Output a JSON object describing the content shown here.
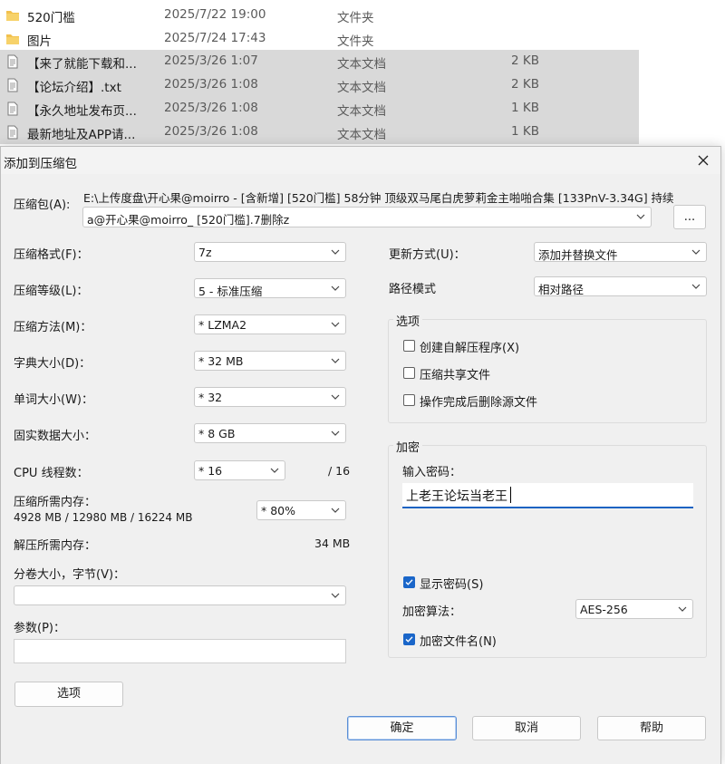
{
  "files": [
    {
      "name": "520门槛",
      "date": "2025/7/22 19:00",
      "type": "文件夹",
      "size": "",
      "icon": "folder-icon",
      "selected": false
    },
    {
      "name": "图片",
      "date": "2025/7/24 17:43",
      "type": "文件夹",
      "size": "",
      "icon": "folder-icon",
      "selected": false
    },
    {
      "name": "【来了就能下载和...",
      "date": "2025/3/26 1:07",
      "type": "文本文档",
      "size": "2 KB",
      "icon": "text-file-icon",
      "selected": true
    },
    {
      "name": "【论坛介绍】.txt",
      "date": "2025/3/26 1:08",
      "type": "文本文档",
      "size": "2 KB",
      "icon": "text-file-icon",
      "selected": true
    },
    {
      "name": "【永久地址发布页...",
      "date": "2025/3/26 1:08",
      "type": "文本文档",
      "size": "1 KB",
      "icon": "text-file-icon",
      "selected": true
    },
    {
      "name": "最新地址及APP请...",
      "date": "2025/3/26 1:08",
      "type": "文本文档",
      "size": "1 KB",
      "icon": "text-file-icon",
      "selected": true
    }
  ],
  "dialog": {
    "title": "添加到压缩包",
    "archive_label": "压缩包(A):",
    "archive_path_line1": "E:\\上传度盘\\开心果@moirro - [含新增] [520门槛] 58分钟 顶级双马尾白虎萝莉金主啪啪合集 [133PnV-3.34G] 持续",
    "archive_path_line2": "a@开心果@moirro_ [520门槛].7删除z",
    "browse_label": "...",
    "left": {
      "format_label": "压缩格式(F)：",
      "format_value": "7z",
      "level_label": "压缩等级(L)：",
      "level_value": "5 - 标准压缩",
      "method_label": "压缩方法(M)：",
      "method_value": "* LZMA2",
      "dict_label": "字典大小(D)：",
      "dict_value": "* 32 MB",
      "word_label": "单词大小(W)：",
      "word_value": "* 32",
      "solid_label": "固实数据大小：",
      "solid_value": "* 8 GB",
      "cpu_label": "CPU 线程数：",
      "cpu_value": "* 16",
      "cpu_total": "/ 16",
      "mem_comp_label": "压缩所需内存：",
      "mem_comp_detail": "4928 MB / 12980 MB / 16224 MB",
      "mem_percent": "* 80%",
      "mem_decomp_label": "解压所需内存：",
      "mem_decomp_value": "34 MB",
      "volume_label": "分卷大小，字节(V)：",
      "volume_value": "",
      "params_label": "参数(P)：",
      "params_value": "",
      "options_button": "选项"
    },
    "right": {
      "update_label": "更新方式(U)：",
      "update_value": "添加并替换文件",
      "path_label": "路径模式",
      "path_value": "相对路径",
      "options_group": "选项",
      "opt_sfx": "创建自解压程序(X)",
      "opt_sfx_checked": false,
      "opt_shared": "压缩共享文件",
      "opt_shared_checked": false,
      "opt_delete": "操作完成后删除源文件",
      "opt_delete_checked": false,
      "encrypt_group": "加密",
      "password_label": "输入密码：",
      "password_value": "上老王论坛当老王",
      "show_password": "显示密码(S)",
      "show_password_checked": true,
      "enc_method_label": "加密算法：",
      "enc_method_value": "AES-256",
      "encrypt_names": "加密文件名(N)",
      "encrypt_names_checked": true
    },
    "buttons": {
      "ok": "确定",
      "cancel": "取消",
      "help": "帮助"
    }
  },
  "colors": {
    "accent": "#1a66c9",
    "selected_row": "#d9d9d9",
    "dialog_bg": "#f0f0f0"
  }
}
